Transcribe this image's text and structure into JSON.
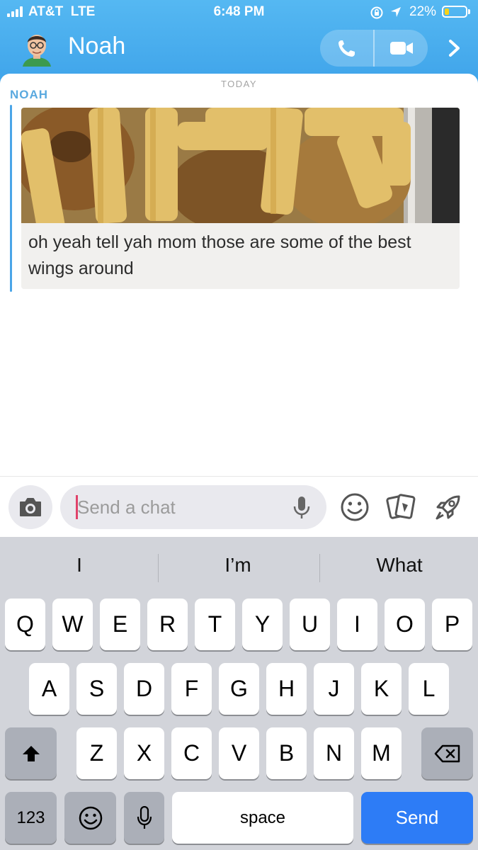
{
  "status_bar": {
    "carrier": "AT&T  LTE",
    "time": "6:48 PM",
    "battery_percent": "22%",
    "battery_level": 0.22
  },
  "header": {
    "contact_name": "Noah",
    "icons": [
      "bitmoji-avatar",
      "phone-icon",
      "video-camera-icon",
      "chevron-right-icon"
    ]
  },
  "chat": {
    "day_label": "TODAY",
    "messages": [
      {
        "sender": "NOAH",
        "media": "photo of fries and chicken wings",
        "caption": "oh yeah tell yah mom those are some of the best wings around"
      }
    ]
  },
  "input_bar": {
    "placeholder": "Send a chat",
    "value": "",
    "icons": [
      "camera-icon",
      "microphone-icon",
      "emoji-icon",
      "cards-icon",
      "rocket-icon"
    ]
  },
  "keyboard": {
    "suggestions": [
      "I",
      "I’m",
      "What"
    ],
    "rows": [
      [
        "Q",
        "W",
        "E",
        "R",
        "T",
        "Y",
        "U",
        "I",
        "O",
        "P"
      ],
      [
        "A",
        "S",
        "D",
        "F",
        "G",
        "H",
        "J",
        "K",
        "L"
      ],
      [
        "Z",
        "X",
        "C",
        "V",
        "B",
        "N",
        "M"
      ]
    ],
    "numbers_key": "123",
    "space_key": "space",
    "send_key": "Send"
  },
  "colors": {
    "header_blue": "#46a9ee",
    "sender_blue": "#5aa9df",
    "send_key_blue": "#2d7cf6",
    "cursor_pink": "#e0426a"
  }
}
